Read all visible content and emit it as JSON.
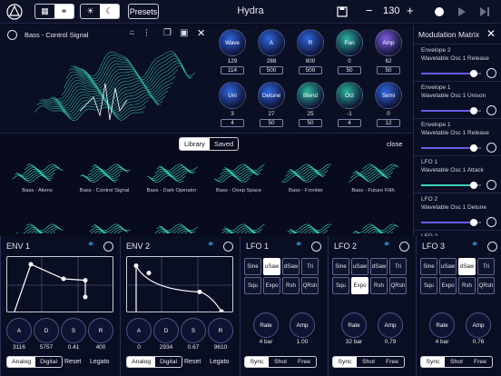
{
  "app": {
    "title": "Hydra",
    "presets": "Presets",
    "value": "130",
    "minus": "−",
    "plus": "+"
  },
  "colors": {
    "accent": "#3ea8e0",
    "teal": "#3fd1b9",
    "purple": "#8b6cf0",
    "blue": "#2f6fe8"
  },
  "wavetable": {
    "title": "Bass - Control Signal",
    "close": "✕"
  },
  "osc_knobs": [
    {
      "label": "Wave",
      "val": "129",
      "box": "114",
      "color": "#2f66e0"
    },
    {
      "label": "A",
      "val": "288",
      "box": "500",
      "color": "#2f66e0"
    },
    {
      "label": "R",
      "val": "800",
      "box": "500",
      "color": "#2f66e0"
    },
    {
      "label": "Pan",
      "val": "0",
      "box": "50",
      "color": "#2bb39e"
    },
    {
      "label": "Amp",
      "val": "62",
      "box": "50",
      "color": "#7f5de0"
    },
    {
      "label": "Uni",
      "val": "3",
      "box": "4",
      "color": "#2f66e0"
    },
    {
      "label": "Detune",
      "val": "27",
      "box": "50",
      "color": "#2f66e0"
    },
    {
      "label": "Blend",
      "val": "25",
      "box": "50",
      "color": "#2bb39e"
    },
    {
      "label": "Oct",
      "val": "-1",
      "box": "4",
      "color": "#2bb39e"
    },
    {
      "label": "Semi",
      "val": "0",
      "box": "12",
      "color": "#2f66e0"
    }
  ],
  "library": {
    "tabs": [
      "Library",
      "Saved"
    ],
    "close": "close",
    "presets": [
      "Bass - Aliens",
      "Bass - Control Signal",
      "Bass - Dark Operator",
      "Bass - Deep Space",
      "Bass - Frontier",
      "Bass - Future Filth"
    ]
  },
  "mod_matrix": {
    "title": "Modulation Matrix",
    "close": "✕",
    "items": [
      {
        "src": "Envelope 2",
        "dst": "Wavetable Osc 1 Release",
        "level": 0.88
      },
      {
        "src": "Envelope 1",
        "dst": "Wavetable Osc 1 Unison",
        "level": 0.88
      },
      {
        "src": "Envelope 1",
        "dst": "Wavetable Osc 1 Release",
        "level": 0.88
      },
      {
        "src": "LFO 1",
        "dst": "Wavetable Osc 1 Attack",
        "level": 0.88
      },
      {
        "src": "LFO 2",
        "dst": "Wavetable Osc 1 Detune",
        "level": 0.88
      },
      {
        "src": "LFO 2",
        "dst": "",
        "level": 0
      }
    ]
  },
  "env1": {
    "title": "ENV 1",
    "knobs": [
      {
        "l": "A",
        "v": "3116"
      },
      {
        "l": "D",
        "v": "5757"
      },
      {
        "l": "S",
        "v": "0.41"
      },
      {
        "l": "R",
        "v": "400"
      }
    ],
    "analog": "Analog",
    "digital": "Digital",
    "reset": "Reset",
    "legato": "Legato"
  },
  "env2": {
    "title": "ENV 2",
    "knobs": [
      {
        "l": "A",
        "v": "0"
      },
      {
        "l": "D",
        "v": "2934"
      },
      {
        "l": "S",
        "v": "0.67"
      },
      {
        "l": "R",
        "v": "9610"
      }
    ],
    "analog": "Analog",
    "digital": "Digital",
    "reset": "Reset",
    "legato": "Legato"
  },
  "lfos": [
    {
      "title": "LFO 1",
      "shapes": [
        "Sine",
        "uSaw",
        "dSaw",
        "Tri",
        "Squ",
        "Expo",
        "Rsh",
        "QRsh"
      ],
      "selected": "uSaw",
      "rate_label": "Rate",
      "amp_label": "Amp",
      "rate": "4 bar",
      "amp": "1.00",
      "sync": [
        "Sync",
        "Shot",
        "Free"
      ],
      "sync_sel": "Sync"
    },
    {
      "title": "LFO 2",
      "shapes": [
        "Sine",
        "uSaw",
        "dSaw",
        "Tri",
        "Squ",
        "Expo",
        "Rsh",
        "QRsh"
      ],
      "selected": "Expo",
      "rate_label": "Rate",
      "amp_label": "Amp",
      "rate": "32 bar",
      "amp": "0.79",
      "sync": [
        "Sync",
        "Shot",
        "Free"
      ],
      "sync_sel": "Sync"
    },
    {
      "title": "LFO 3",
      "shapes": [
        "Sine",
        "uSaw",
        "dSaw",
        "Tri",
        "Squ",
        "Expo",
        "Rsh",
        "QRsh"
      ],
      "selected": "dSaw",
      "rate_label": "Rate",
      "amp_label": "Amp",
      "rate": "4 bar",
      "amp": "0.76",
      "sync": [
        "Sync",
        "Shot",
        "Free"
      ],
      "sync_sel": "Sync"
    }
  ]
}
